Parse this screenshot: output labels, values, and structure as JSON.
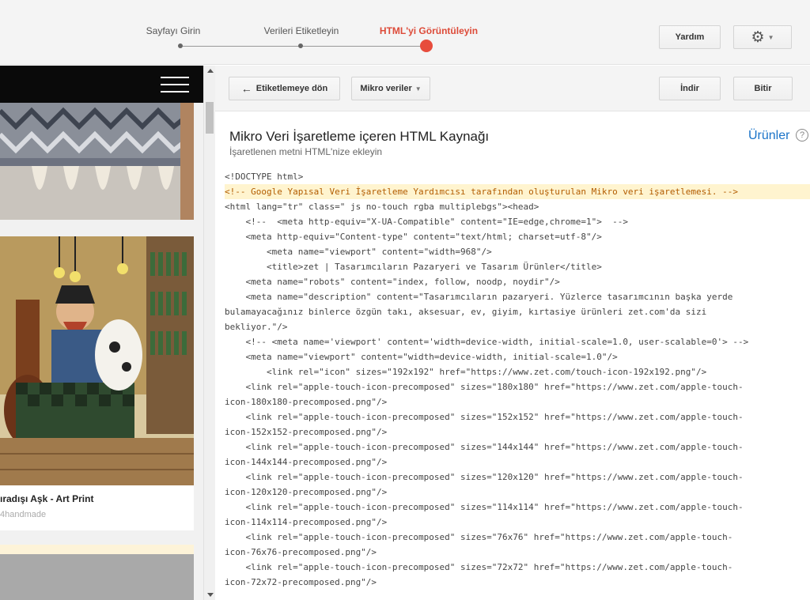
{
  "steps": [
    {
      "label": "Sayfayı Girin",
      "active": false
    },
    {
      "label": "Verileri Etiketleyin",
      "active": false
    },
    {
      "label": "HTML'yi Görüntüleyin",
      "active": true
    }
  ],
  "header": {
    "help_label": "Yardım",
    "settings_icon": "gear-icon"
  },
  "left_preview": {
    "product_title": "ıradışı Aşk - Art Print",
    "product_seller": "4handmade"
  },
  "toolbar": {
    "back_label": "Etiketlemeye dön",
    "microdata_label": "Mikro veriler",
    "download_label": "İndir",
    "finish_label": "Bitir"
  },
  "panel": {
    "title": "Mikro Veri İşaretleme içeren HTML Kaynağı",
    "subtitle": "İşaretlenen metni HTML'nize ekleyin",
    "products_link": "Ürünler"
  },
  "code_lines": [
    {
      "text": "<!DOCTYPE html>",
      "highlight": false
    },
    {
      "text": "<!-- Google Yapısal Veri İşaretleme Yardımcısı tarafından oluşturulan Mikro veri işaretlemesi. -->",
      "highlight": true
    },
    {
      "text": "<html lang=\"tr\" class=\" js no-touch rgba multiplebgs\"><head>",
      "highlight": false
    },
    {
      "text": "    <!--  <meta http-equiv=\"X-UA-Compatible\" content=\"IE=edge,chrome=1\">  -->",
      "highlight": false
    },
    {
      "text": "    <meta http-equiv=\"Content-type\" content=\"text/html; charset=utf-8\"/>",
      "highlight": false
    },
    {
      "text": "        <meta name=\"viewport\" content=\"width=968\"/>",
      "highlight": false
    },
    {
      "text": "        <title>zet | Tasarımcıların Pazaryeri ve Tasarım Ürünler</title>",
      "highlight": false
    },
    {
      "text": "    <meta name=\"robots\" content=\"index, follow, noodp, noydir\"/>",
      "highlight": false
    },
    {
      "text": "    <meta name=\"description\" content=\"Tasarımcıların pazaryeri. Yüzlerce tasarımcının başka yerde",
      "highlight": false
    },
    {
      "text": "bulamayacağınız binlerce özgün takı, aksesuar, ev, giyim, kırtasiye ürünleri zet.com'da sizi",
      "highlight": false
    },
    {
      "text": "bekliyor.\"/>",
      "highlight": false
    },
    {
      "text": "    <!-- <meta name='viewport' content='width=device-width, initial-scale=1.0, user-scalable=0'> -->",
      "highlight": false
    },
    {
      "text": "    <meta name=\"viewport\" content=\"width=device-width, initial-scale=1.0\"/>",
      "highlight": false
    },
    {
      "text": "        <link rel=\"icon\" sizes=\"192x192\" href=\"https://www.zet.com/touch-icon-192x192.png\"/>",
      "highlight": false
    },
    {
      "text": "    <link rel=\"apple-touch-icon-precomposed\" sizes=\"180x180\" href=\"https://www.zet.com/apple-touch-",
      "highlight": false
    },
    {
      "text": "icon-180x180-precomposed.png\"/>",
      "highlight": false
    },
    {
      "text": "    <link rel=\"apple-touch-icon-precomposed\" sizes=\"152x152\" href=\"https://www.zet.com/apple-touch-",
      "highlight": false
    },
    {
      "text": "icon-152x152-precomposed.png\"/>",
      "highlight": false
    },
    {
      "text": "    <link rel=\"apple-touch-icon-precomposed\" sizes=\"144x144\" href=\"https://www.zet.com/apple-touch-",
      "highlight": false
    },
    {
      "text": "icon-144x144-precomposed.png\"/>",
      "highlight": false
    },
    {
      "text": "    <link rel=\"apple-touch-icon-precomposed\" sizes=\"120x120\" href=\"https://www.zet.com/apple-touch-",
      "highlight": false
    },
    {
      "text": "icon-120x120-precomposed.png\"/>",
      "highlight": false
    },
    {
      "text": "    <link rel=\"apple-touch-icon-precomposed\" sizes=\"114x114\" href=\"https://www.zet.com/apple-touch-",
      "highlight": false
    },
    {
      "text": "icon-114x114-precomposed.png\"/>",
      "highlight": false
    },
    {
      "text": "    <link rel=\"apple-touch-icon-precomposed\" sizes=\"76x76\" href=\"https://www.zet.com/apple-touch-",
      "highlight": false
    },
    {
      "text": "icon-76x76-precomposed.png\"/>",
      "highlight": false
    },
    {
      "text": "    <link rel=\"apple-touch-icon-precomposed\" sizes=\"72x72\" href=\"https://www.zet.com/apple-touch-",
      "highlight": false
    },
    {
      "text": "icon-72x72-precomposed.png\"/>",
      "highlight": false
    }
  ],
  "colors": {
    "accent": "#dd4b39",
    "active_dot": "#e74c3c",
    "link": "#1a73c8",
    "highlight_bg": "#fff4cf",
    "highlight_text": "#b25c00"
  }
}
